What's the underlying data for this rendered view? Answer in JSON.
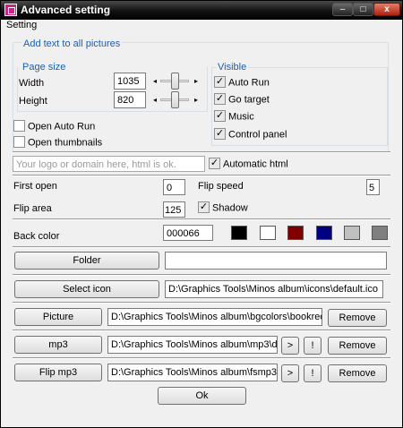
{
  "window": {
    "title": "Advanced setting",
    "min_glyph": "–",
    "max_glyph": "□",
    "close_glyph": "x"
  },
  "menu": {
    "setting": "Setting"
  },
  "add_text_group": {
    "title": "Add text to all pictures"
  },
  "page_size": {
    "title": "Page size",
    "width_label": "Width",
    "width_value": "1035",
    "height_label": "Height",
    "height_value": "820",
    "left_arrow": "◂",
    "right_arrow": "▸"
  },
  "visible": {
    "title": "Visible",
    "items": [
      {
        "label": "Auto Run",
        "checked": true
      },
      {
        "label": "Go target",
        "checked": true
      },
      {
        "label": "Music",
        "checked": true
      },
      {
        "label": "Control panel",
        "checked": true
      }
    ]
  },
  "open_auto_run": {
    "label": "Open Auto Run",
    "checked": false
  },
  "open_thumbnails": {
    "label": "Open thumbnails",
    "checked": false
  },
  "logo_input": {
    "placeholder": "Your logo or domain here, html is ok."
  },
  "automatic_html": {
    "label": "Automatic html",
    "checked": true
  },
  "first_open": {
    "label": "First open",
    "value": "0"
  },
  "flip_speed": {
    "label": "Flip speed",
    "value": "5"
  },
  "flip_area": {
    "label": "Flip area",
    "value": "125"
  },
  "shadow": {
    "label": "Shadow",
    "checked": true
  },
  "back_color": {
    "label": "Back color",
    "value": "000066",
    "swatches": [
      "#000000",
      "#ffffff",
      "#800000",
      "#000080",
      "#c0c0c0",
      "#808080"
    ]
  },
  "folder": {
    "button": "Folder",
    "value": ""
  },
  "select_icon": {
    "button": "Select icon",
    "value": "D:\\Graphics Tools\\Minos album\\icons\\default.ico"
  },
  "picture": {
    "button": "Picture",
    "value": "D:\\Graphics Tools\\Minos album\\bgcolors\\bookred.gi",
    "remove": "Remove"
  },
  "mp3": {
    "button": "mp3",
    "value": "D:\\Graphics Tools\\Minos album\\mp3\\defa",
    "play": ">",
    "stop": "!",
    "remove": "Remove"
  },
  "flip_mp3": {
    "button": "Flip mp3",
    "value": "D:\\Graphics Tools\\Minos album\\fsmp3\\de",
    "play": ">",
    "stop": "!",
    "remove": "Remove"
  },
  "ok": {
    "label": "Ok"
  },
  "check_glyph": "✓"
}
